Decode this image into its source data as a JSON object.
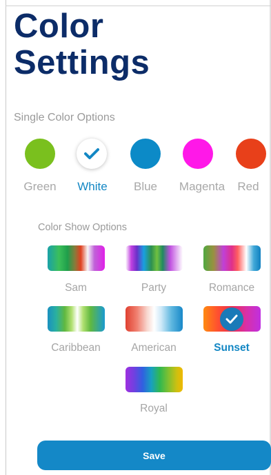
{
  "page": {
    "title_line1": "Color",
    "title_line2": "Settings"
  },
  "single_color": {
    "section_label": "Single Color Options",
    "options": [
      {
        "label": "Green",
        "color": "#7ac01e",
        "selected": false
      },
      {
        "label": "White",
        "color": "#ffffff",
        "selected": true
      },
      {
        "label": "Blue",
        "color": "#0c8ac7",
        "selected": false
      },
      {
        "label": "Magenta",
        "color": "#ff18e8",
        "selected": false
      },
      {
        "label": "Red",
        "color": "#e8401a",
        "selected": false
      }
    ]
  },
  "color_show": {
    "section_label": "Color Show Options",
    "options": [
      {
        "label": "Sam",
        "selected": false
      },
      {
        "label": "Party",
        "selected": false
      },
      {
        "label": "Romance",
        "selected": false
      },
      {
        "label": "Caribbean",
        "selected": false
      },
      {
        "label": "American",
        "selected": false
      },
      {
        "label": "Sunset",
        "selected": true
      },
      {
        "label": "Royal",
        "selected": false
      }
    ]
  },
  "actions": {
    "save_label": "Save"
  },
  "colors": {
    "title": "#0c2c68",
    "accent": "#1387c4",
    "button": "#1488c7"
  },
  "icons": {
    "selected": "checkmark-icon"
  }
}
